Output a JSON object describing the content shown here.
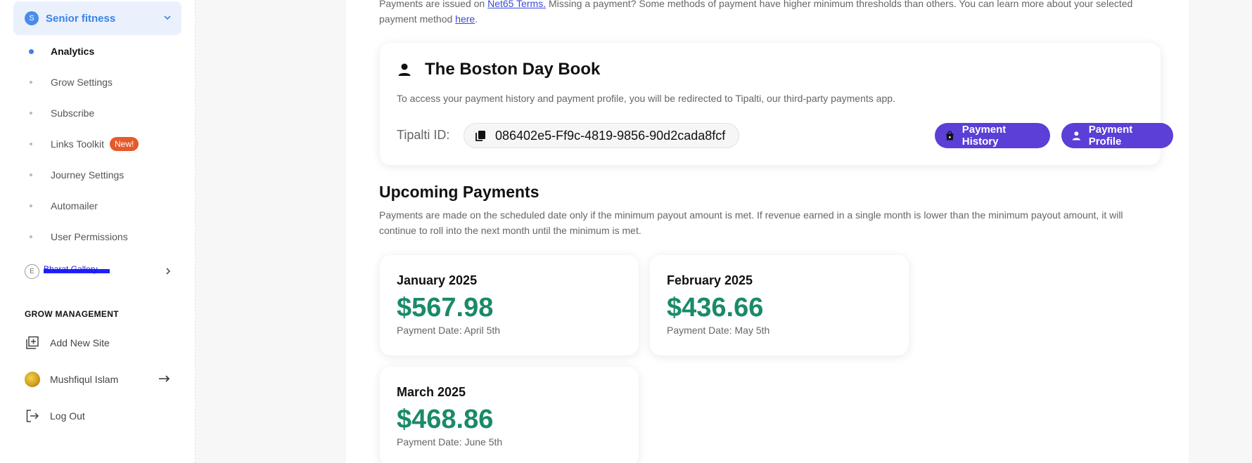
{
  "sidebar": {
    "site_selector": {
      "badge": "S",
      "name": "Senior fitness"
    },
    "nav_items": [
      {
        "label": "Analytics",
        "active": true
      },
      {
        "label": "Grow Settings"
      },
      {
        "label": "Subscribe"
      },
      {
        "label": "Links Toolkit",
        "badge": "New!"
      },
      {
        "label": "Journey Settings"
      },
      {
        "label": "Automailer"
      },
      {
        "label": "User Permissions"
      }
    ],
    "site2": {
      "badge": "E",
      "name": "Bharat Gallery"
    },
    "section_title": "GROW MANAGEMENT",
    "management": {
      "add_site": "Add New Site",
      "user": "Mushfiqul Islam",
      "logout": "Log Out"
    }
  },
  "main": {
    "intro": {
      "part1": "Payments are issued on ",
      "link1": "Net65 Terms.",
      "part2": " Missing a payment? Some methods of payment have higher minimum thresholds than others. You can learn more about your selected payment method ",
      "link2": "here",
      "part3": "."
    },
    "account": {
      "title": "The Boston Day Book",
      "description": "To access your payment history and payment profile, you will be redirected to Tipalti, our third-party payments app.",
      "tipalti_label": "Tipalti ID:",
      "tipalti_id": "086402e5-Ff9c-4819-9856-90d2cada8fcf",
      "history_button": "Payment History",
      "profile_button": "Payment Profile"
    },
    "upcoming": {
      "title": "Upcoming Payments",
      "description": "Payments are made on the scheduled date only if the minimum payout amount is met. If revenue earned in a single month is lower than the minimum payout amount, it will continue to roll into the next month until the minimum is met.",
      "payments": [
        {
          "month": "January 2025",
          "amount": "$567.98",
          "date": "Payment Date: April 5th"
        },
        {
          "month": "February 2025",
          "amount": "$436.66",
          "date": "Payment Date: May 5th"
        },
        {
          "month": "March 2025",
          "amount": "$468.86",
          "date": "Payment Date: June 5th"
        }
      ]
    }
  },
  "colors": {
    "accent_blue": "#3b82e6",
    "button_purple": "#5b3fd6",
    "amount_green": "#1a8a69",
    "badge_orange": "#e55a2b"
  }
}
